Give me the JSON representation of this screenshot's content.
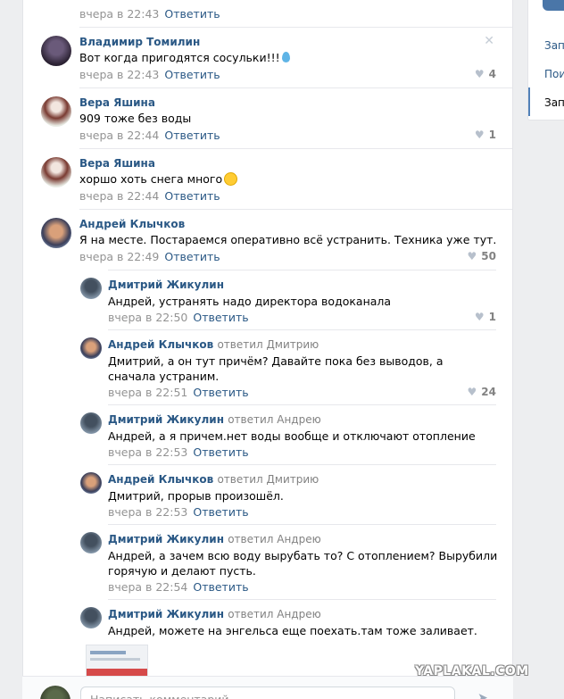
{
  "sidebar": {
    "items": [
      {
        "label": "Зап"
      },
      {
        "label": "Пои"
      },
      {
        "label": "Зап"
      }
    ]
  },
  "comments": [
    {
      "author": "Владимир Томилин",
      "text": "Вот когда пригодятся сосульки!!!",
      "time": "вчера в 22:43",
      "reply": "Ответить",
      "likes": "4"
    },
    {
      "author": "Вера Яшина",
      "text": "909 тоже без воды",
      "time": "вчера в 22:44",
      "reply": "Ответить",
      "likes": "1"
    },
    {
      "author": "Вера Яшина",
      "text": "хоршо хоть снега много",
      "time": "вчера в 22:44",
      "reply": "Ответить"
    },
    {
      "author": "Андрей Клычков",
      "text": "Я на месте. Постараемся оперативно всё устранить. Техника уже тут.",
      "time": "вчера в 22:49",
      "reply": "Ответить",
      "likes": "50"
    }
  ],
  "replies": [
    {
      "author": "Дмитрий Жикулин",
      "replied_to": "",
      "text": "Андрей, устранять надо директора водоканала",
      "time": "вчера в 22:50",
      "reply": "Ответить",
      "likes": "1"
    },
    {
      "author": "Андрей Клычков",
      "replied_to": "ответил Дмитрию",
      "text": "Дмитрий, а он тут причём? Давайте пока без выводов, а сначала устраним.",
      "time": "вчера в 22:51",
      "reply": "Ответить",
      "likes": "24"
    },
    {
      "author": "Дмитрий Жикулин",
      "replied_to": "ответил Андрею",
      "text": "Андрей, а я причем.нет воды вообще и отключают отопление",
      "time": "вчера в 22:53",
      "reply": "Ответить"
    },
    {
      "author": "Андрей Клычков",
      "replied_to": "ответил Дмитрию",
      "text": "Дмитрий, прорыв произошёл.",
      "time": "вчера в 22:53",
      "reply": "Ответить"
    },
    {
      "author": "Дмитрий Жикулин",
      "replied_to": "ответил Андрею",
      "text": "Андрей, а зачем всю воду вырубать то? С отоплением? Вырубили горячую и делают пусть.",
      "time": "вчера в 22:54",
      "reply": "Ответить"
    },
    {
      "author": "Дмитрий Жикулин",
      "replied_to": "ответил Андрею",
      "text": "Андрей, можете на энгельса еще поехать.там тоже заливает.",
      "time": "",
      "reply": ""
    }
  ],
  "top_partial": {
    "time": "вчера в 22:43",
    "reply": "Ответить"
  },
  "input": {
    "placeholder": "Написать комментарий..."
  },
  "watermark": "YAPLAKAL.COM",
  "colors": {
    "link": "#2a5885",
    "meta": "#939393",
    "accent": "#5181b8"
  }
}
